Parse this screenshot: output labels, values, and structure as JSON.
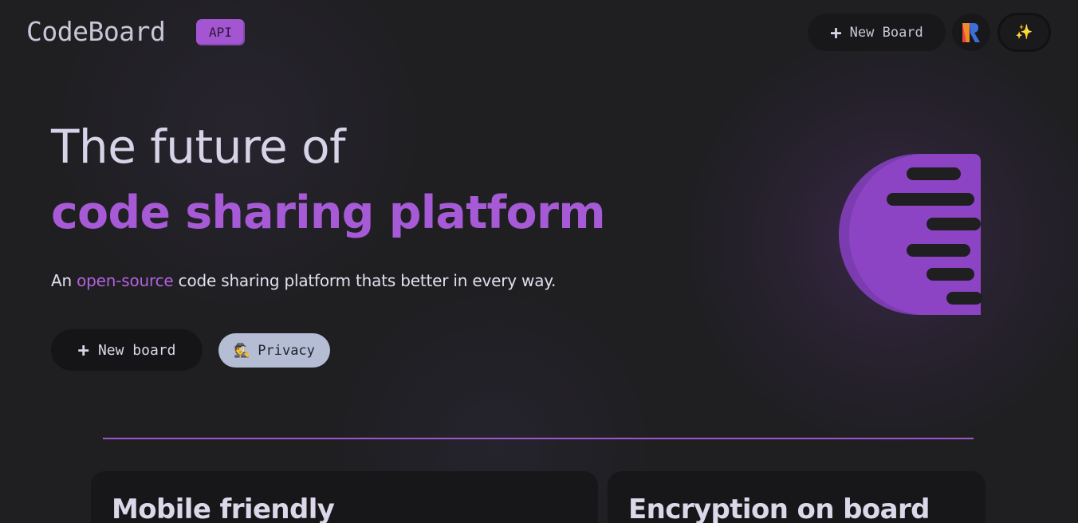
{
  "header": {
    "logo_text": "CodeBoard",
    "api_badge": "API",
    "new_board_label": "New Board",
    "magic_icon_glyph": "✨"
  },
  "hero": {
    "title_line1": "The future of",
    "title_line2": "code sharing platform",
    "subtitle_prefix": "An ",
    "subtitle_accent": "open-source",
    "subtitle_suffix": " code sharing platform thats better in every way.",
    "new_board_label": "New board",
    "privacy_label": "Privacy",
    "privacy_icon_glyph": "🕵"
  },
  "features": [
    {
      "title": "Mobile friendly"
    },
    {
      "title": "Encryption on board"
    }
  ],
  "colors": {
    "accent": "#a65ad6",
    "background": "#1f1f22",
    "privacy_button": "#b4bdd3"
  },
  "icons": {
    "plus": "plus-icon",
    "avatar": "brand-avatar-icon",
    "magic": "sparkles-icon",
    "privacy": "detective-icon",
    "hero_logo": "codeboard-logo-icon"
  }
}
